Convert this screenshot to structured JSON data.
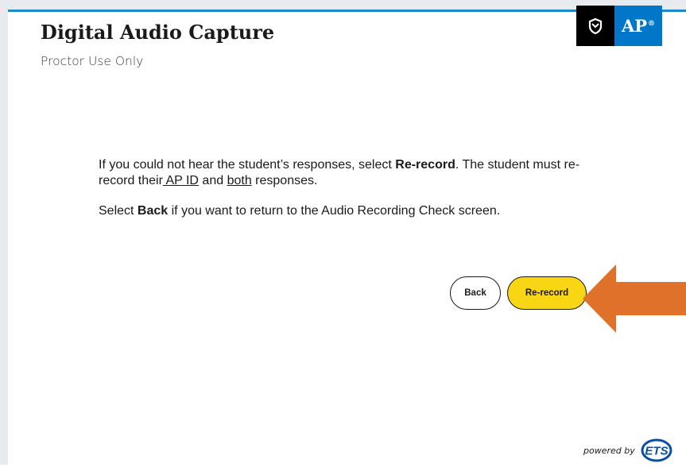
{
  "header": {
    "title": "Digital Audio Capture",
    "subtitle": "Proctor Use Only"
  },
  "brand": {
    "label": "AP",
    "mark": "®",
    "icon": "college-board-shield-icon"
  },
  "message": {
    "line1_prefix": "If you could not hear the student’s responses, select ",
    "line1_bold": "Re-record",
    "line1_suffix": ". The student must re-record their",
    "ap_id_link": " AP ID",
    "and_word": " and ",
    "both_link": "both",
    "line1_end": " responses.",
    "line2_prefix": "Select ",
    "line2_bold": "Back",
    "line2_suffix": " if you want to return to the Audio Recording Check screen."
  },
  "actions": {
    "back_label": "Back",
    "rerecord_label": "Re-record"
  },
  "footer": {
    "powered_by": "powered by",
    "logo_text": "ETS"
  },
  "colors": {
    "top_border": "#1a8ac9",
    "ap_blue": "#0077c8",
    "button_yellow": "#f9d613",
    "arrow_orange": "#e0712a"
  }
}
